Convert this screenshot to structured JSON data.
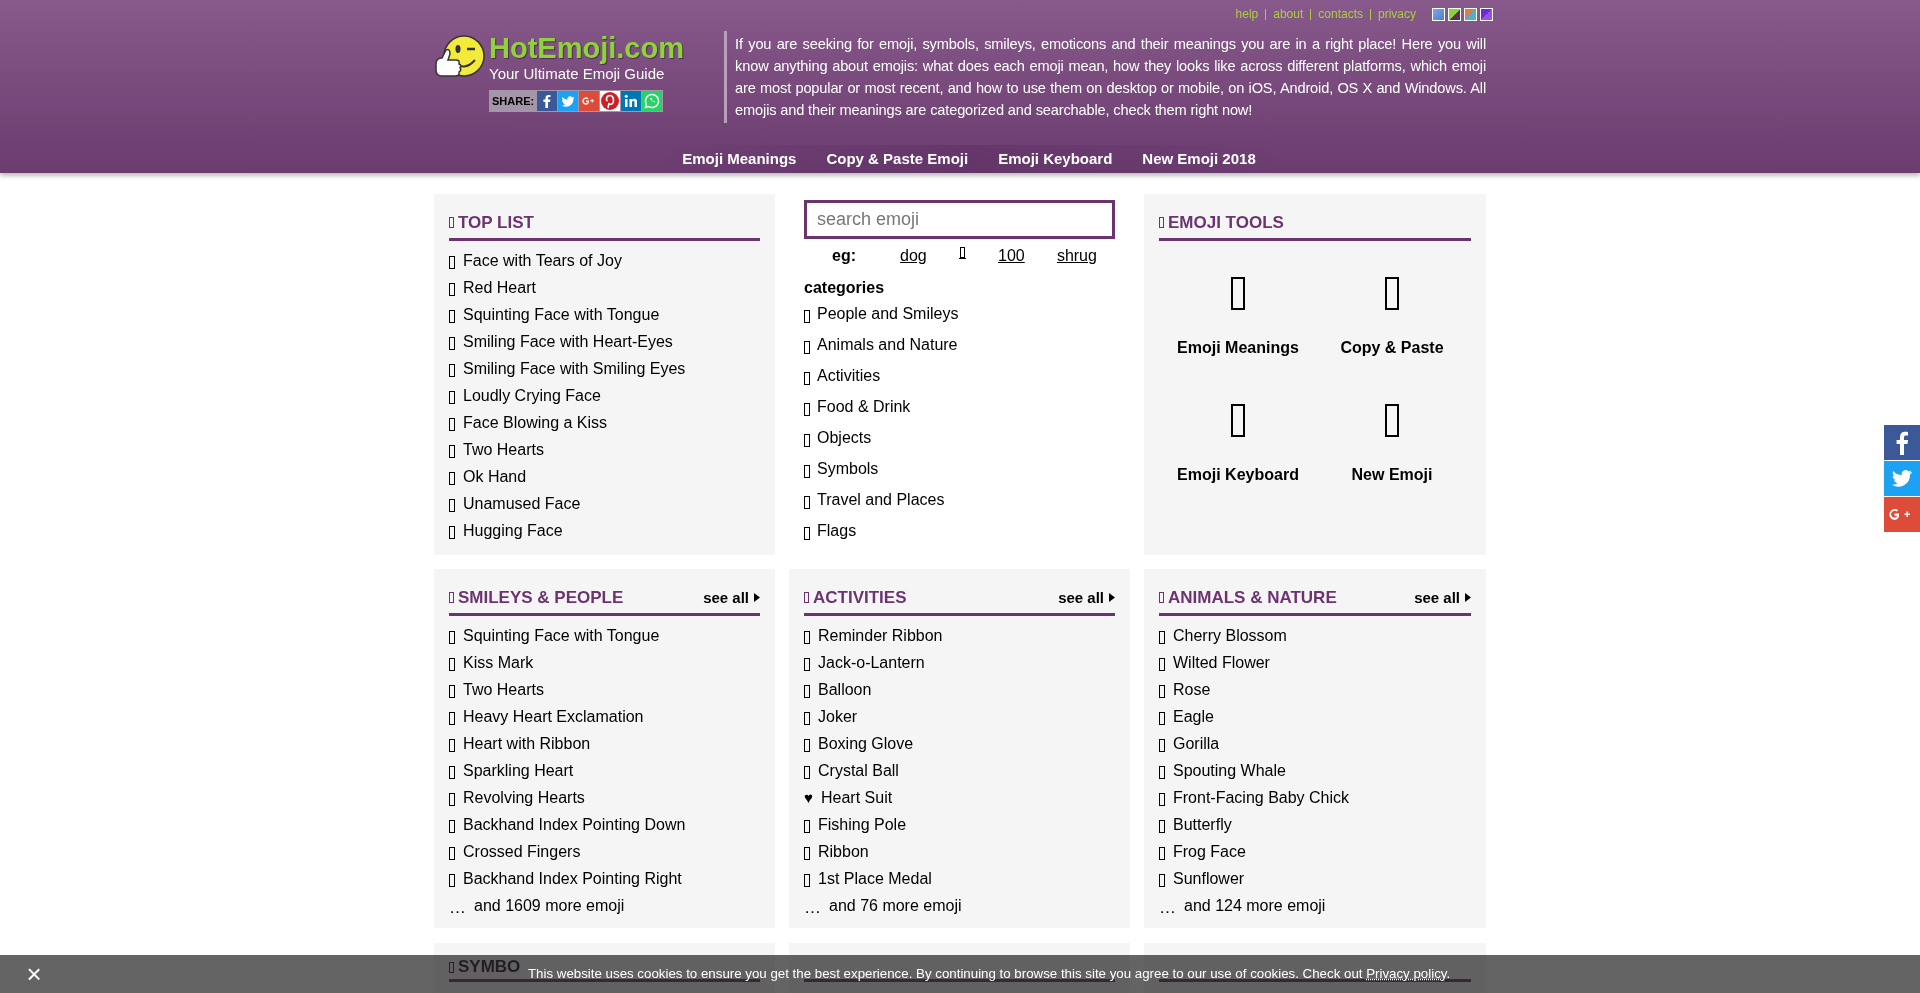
{
  "top_links": [
    "help",
    "about",
    "contacts",
    "privacy"
  ],
  "logo": {
    "title": "HotEmoji.com",
    "tagline": "Your Ultimate Emoji Guide"
  },
  "share": {
    "label": "SHARE:"
  },
  "description": "If you are seeking for emoji, symbols, smileys, emoticons and their meanings you are in a right place! Here you will know anything about emojis: what does each emoji mean, how they looks like across different platforms, which emoji are most popular or most recent, and how to use them on desktop or mobile, on iOS, Android, OS X and Windows. All emojis and their meanings are categorized and searchable, check them right now!",
  "nav": [
    "Emoji Meanings",
    "Copy & Paste Emoji",
    "Emoji Keyboard",
    "New Emoji 2018"
  ],
  "top_list": {
    "title": "TOP LIST",
    "items": [
      {
        "label": "Face with Tears of Joy"
      },
      {
        "label": "Red Heart"
      },
      {
        "label": "Squinting Face with Tongue"
      },
      {
        "label": "Smiling Face with Heart-Eyes"
      },
      {
        "label": "Smiling Face with Smiling Eyes"
      },
      {
        "label": "Loudly Crying Face"
      },
      {
        "label": "Face Blowing a Kiss"
      },
      {
        "label": "Two Hearts"
      },
      {
        "label": "Ok Hand"
      },
      {
        "label": "Unamused Face"
      },
      {
        "label": "Hugging Face"
      }
    ]
  },
  "search": {
    "placeholder": "search emoji",
    "examples_label": "eg:",
    "examples": [
      {
        "kind": "text",
        "text": "dog"
      },
      {
        "kind": "glyph"
      },
      {
        "kind": "text",
        "text": "100"
      },
      {
        "kind": "text",
        "text": "shrug"
      }
    ]
  },
  "categories": {
    "title": "categories",
    "items": [
      "People and Smileys",
      "Animals and Nature",
      "Activities",
      "Food & Drink",
      "Objects",
      "Symbols",
      "Travel and Places",
      "Flags"
    ]
  },
  "tools": {
    "title": "EMOJI TOOLS",
    "items": [
      "Emoji Meanings",
      "Copy & Paste",
      "Emoji Keyboard",
      "New Emoji"
    ]
  },
  "sections": [
    {
      "title": "SMILEYS & PEOPLE",
      "see_all": "see all",
      "items": [
        {
          "label": "Squinting Face with Tongue"
        },
        {
          "label": "Kiss Mark"
        },
        {
          "label": "Two Hearts"
        },
        {
          "label": "Heavy Heart Exclamation"
        },
        {
          "label": "Heart with Ribbon"
        },
        {
          "label": "Sparkling Heart"
        },
        {
          "label": "Revolving Hearts"
        },
        {
          "label": "Backhand Index Pointing Down"
        },
        {
          "label": "Crossed Fingers"
        },
        {
          "label": "Backhand Index Pointing Right"
        }
      ],
      "more_mark": "…",
      "more": "and 1609 more emoji"
    },
    {
      "title": "ACTIVITIES",
      "see_all": "see all",
      "items": [
        {
          "label": "Reminder Ribbon"
        },
        {
          "label": "Jack-o-Lantern"
        },
        {
          "label": "Balloon"
        },
        {
          "label": "Joker"
        },
        {
          "label": "Boxing Glove"
        },
        {
          "label": "Crystal Ball"
        },
        {
          "label": "Heart Suit",
          "symbol": "♥"
        },
        {
          "label": "Fishing Pole"
        },
        {
          "label": "Ribbon"
        },
        {
          "label": "1st Place Medal"
        }
      ],
      "more_mark": "…",
      "more": "and 76 more emoji"
    },
    {
      "title": "ANIMALS & NATURE",
      "see_all": "see all",
      "items": [
        {
          "label": "Cherry Blossom"
        },
        {
          "label": "Wilted Flower"
        },
        {
          "label": "Rose"
        },
        {
          "label": "Eagle"
        },
        {
          "label": "Gorilla"
        },
        {
          "label": "Spouting Whale"
        },
        {
          "label": "Front-Facing Baby Chick"
        },
        {
          "label": "Butterfly"
        },
        {
          "label": "Frog Face"
        },
        {
          "label": "Sunflower"
        }
      ],
      "more_mark": "…",
      "more": "and 124 more emoji"
    }
  ],
  "partial_sections": [
    {
      "title": "SYMBO"
    }
  ],
  "cookie_bar": {
    "close": "×",
    "text": "This website uses cookies to ensure you get the best experience. By continuing to browse this site you agree to our use of cookies. Check out ",
    "link": "Privacy policy",
    "end": "."
  }
}
